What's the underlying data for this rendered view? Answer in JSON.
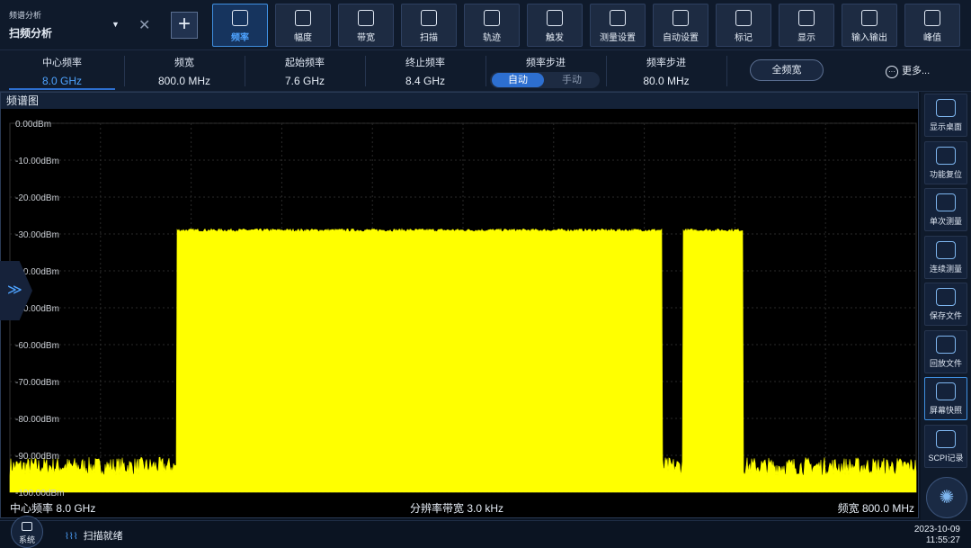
{
  "header": {
    "mode_sub": "频谱分析",
    "mode_main": "扫频分析",
    "toolbar": [
      {
        "label": "频率",
        "icon": "frequency-icon",
        "active": true
      },
      {
        "label": "幅度",
        "icon": "amplitude-icon"
      },
      {
        "label": "带宽",
        "icon": "bandwidth-icon"
      },
      {
        "label": "扫描",
        "icon": "sweep-icon"
      },
      {
        "label": "轨迹",
        "icon": "trace-icon"
      },
      {
        "label": "触发",
        "icon": "trigger-icon"
      },
      {
        "label": "测量设置",
        "icon": "measure-setup-icon"
      },
      {
        "label": "自动设置",
        "icon": "auto-setup-icon"
      },
      {
        "label": "标记",
        "icon": "marker-icon"
      },
      {
        "label": "显示",
        "icon": "display-icon"
      },
      {
        "label": "输入输出",
        "icon": "io-icon"
      },
      {
        "label": "峰值",
        "icon": "peak-icon"
      }
    ]
  },
  "params": {
    "center_label": "中心频率",
    "center_value": "8.0 GHz",
    "span_label": "频宽",
    "span_value": "800.0 MHz",
    "start_label": "起始频率",
    "start_value": "7.6 GHz",
    "stop_label": "终止频率",
    "stop_value": "8.4 GHz",
    "step_mode_label": "频率步进",
    "step_auto": "自动",
    "step_manual": "手动",
    "step_label": "频率步进",
    "step_value": "80.0 MHz",
    "full_span": "全频宽",
    "more": "更多..."
  },
  "panel": {
    "title": "频谱图",
    "footer_left": "中心频率 8.0 GHz",
    "footer_center": "分辨率带宽 3.0 kHz",
    "footer_right": "频宽 800.0 MHz"
  },
  "chart_data": {
    "type": "line",
    "y_ticks": [
      "0.00dBm",
      "-10.00dBm",
      "-20.00dBm",
      "-30.00dBm",
      "-40.00dBm",
      "-50.00dBm",
      "-60.00dBm",
      "-70.00dBm",
      "-80.00dBm",
      "-90.00dBm",
      "-100.00dBm"
    ],
    "ylim": [
      -100,
      0
    ],
    "xlim_ghz": [
      7.6,
      8.4
    ],
    "grid": true,
    "trace_color": "#ffff00",
    "noise_floor_dbm": -94,
    "signals": [
      {
        "start_ghz": 7.747,
        "stop_ghz": 8.176,
        "level_dbm": -29
      },
      {
        "start_ghz": 8.194,
        "stop_ghz": 8.247,
        "level_dbm": -29
      }
    ]
  },
  "sidebar": [
    {
      "label": "显示桌面",
      "icon": "home-icon"
    },
    {
      "label": "功能复位",
      "icon": "reset-icon"
    },
    {
      "label": "单次测量",
      "icon": "single-measure-icon"
    },
    {
      "label": "连续测量",
      "icon": "continuous-measure-icon"
    },
    {
      "label": "保存文件",
      "icon": "save-icon"
    },
    {
      "label": "回放文件",
      "icon": "folder-icon"
    },
    {
      "label": "屏幕快照",
      "icon": "camera-icon"
    },
    {
      "label": "SCPI记录",
      "icon": "scpi-icon"
    }
  ],
  "status": {
    "system": "系统",
    "state": "扫描就绪",
    "date": "2023-10-09",
    "time": "11:55:27"
  }
}
